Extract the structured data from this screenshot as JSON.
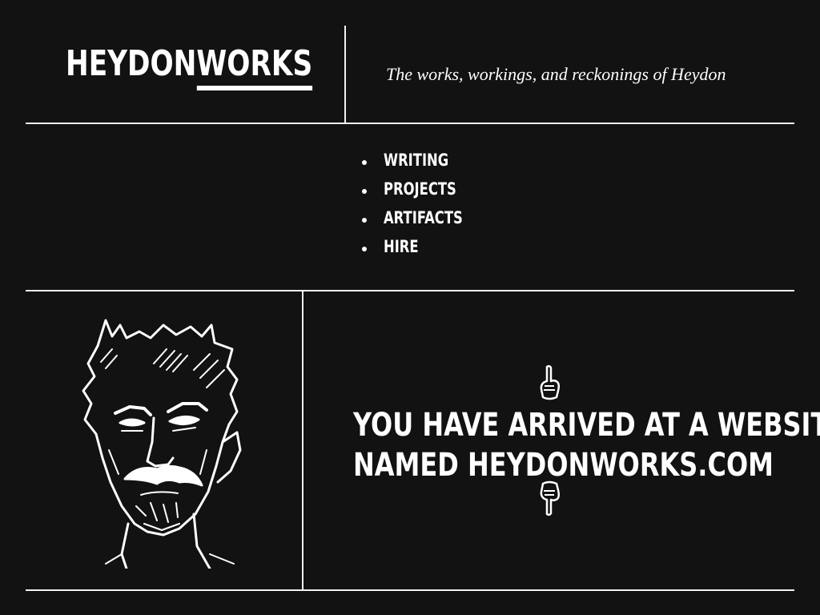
{
  "header": {
    "logo_part1": "HEYDON",
    "logo_part2": "WORKS",
    "tagline": "The works, workings, and reckonings of Heydon"
  },
  "nav": {
    "items": [
      {
        "label": "WRITING"
      },
      {
        "label": "PROJECTS"
      },
      {
        "label": "ARTIFACTS"
      },
      {
        "label": "HIRE"
      }
    ]
  },
  "main": {
    "message_line1": "YOU HAVE ARRIVED AT A WEBSITE",
    "message_line2": "NAMED HEYDONWORKS.COM",
    "hand_icon_top": "pointing-up-hand-icon",
    "hand_icon_bottom": "pointing-down-hand-icon",
    "portrait": "heydon-portrait-illustration"
  },
  "colors": {
    "background": "#121212",
    "foreground": "#ffffff"
  }
}
